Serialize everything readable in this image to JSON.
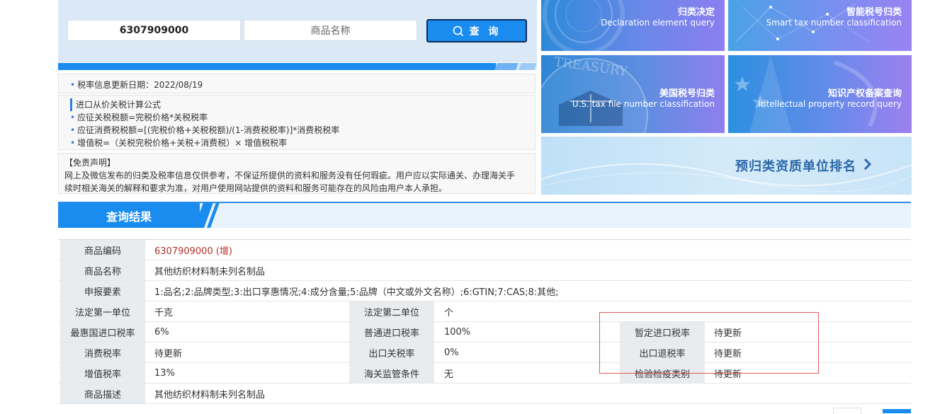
{
  "search": {
    "code_value": "6307909000",
    "name_placeholder": "商品名称",
    "query_label": "查 询"
  },
  "info": {
    "update_date": "税率信息更新日期：2022/08/19",
    "formula_title": "进口从价关税计算公式",
    "formulas": [
      "应征关税税额=完税价格*关税税率",
      "应征消费税税额=[(完税价格+关税税额)/(1-消费税税率)]*消费税税率",
      "增值税=（关税完税价格+关税+消费税）× 增值税税率"
    ],
    "disclaimer_title": "【免责声明】",
    "disclaimer_lines": [
      "网上及微信发布的归类及税率信息仅供参考，不保证所提供的资料和服务没有任何瑕疵。用户应以实际通关、办理海关手",
      "续时相关海关的解释和要求为准，对用户使用网站提供的资料和服务可能存在的风险由用户本人承担。"
    ]
  },
  "tiles": {
    "classify": {
      "title": "归类决定",
      "subtitle": "Declaration element query"
    },
    "smart": {
      "title": "智能税号归类",
      "subtitle": "Smart tax number classification"
    },
    "us": {
      "title": "美国税号归类",
      "subtitle": "U.S. tax file number classification",
      "seal_text": "TREASURY"
    },
    "ip": {
      "title": "知识产权备案查询",
      "subtitle": "Intellectual property record query"
    },
    "ranking": {
      "title": "预归类资质单位排名"
    }
  },
  "results": {
    "header": "查询结果",
    "rows": {
      "code": {
        "label": "商品编码",
        "value": "6307909000 (增)"
      },
      "name": {
        "label": "商品名称",
        "value": "其他纺织材料制未列名制品"
      },
      "elements": {
        "label": "申报要素",
        "value": "1:品名;2:品牌类型;3:出口享惠情况;4:成分含量;5:品牌（中文或外文名称）;6:GTIN;7:CAS;8:其他;"
      },
      "unit1": {
        "label": "法定第一单位",
        "value": "千克"
      },
      "unit2": {
        "label": "法定第二单位",
        "value": "个"
      },
      "mfn": {
        "label": "最惠国进口税率",
        "value": "6%"
      },
      "general": {
        "label": "普通进口税率",
        "value": "100%"
      },
      "provisional": {
        "label": "暂定进口税率",
        "value": "待更新"
      },
      "consumption": {
        "label": "消费税率",
        "value": "待更新"
      },
      "export_tariff": {
        "label": "出口关税率",
        "value": "0%"
      },
      "export_rebate": {
        "label": "出口退税率",
        "value": "待更新"
      },
      "vat": {
        "label": "增值税率",
        "value": "13%"
      },
      "supervision": {
        "label": "海关监管条件",
        "value": "无"
      },
      "inspection": {
        "label": "检验检疫类别",
        "value": "待更新"
      },
      "description": {
        "label": "商品描述",
        "value": "其他纺织材料制未列名制品"
      }
    }
  },
  "colors": {
    "accent": "#1a8cf0",
    "code_red": "#b3302a",
    "highlight": "#e05a5a"
  }
}
